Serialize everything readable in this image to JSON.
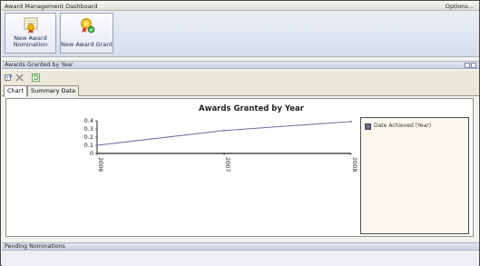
{
  "window": {
    "title": "Award Management Dashboard",
    "options_label": "Options..."
  },
  "ribbon": {
    "buttons": [
      {
        "label": "New Award Nomination",
        "icon": "award-nomination-icon"
      },
      {
        "label": "New Award Grant",
        "icon": "award-grant-icon"
      }
    ]
  },
  "awards_panel": {
    "title": "Awards Granted by Year",
    "toolbar_icons": [
      "grid-settings-icon",
      "delete-icon",
      "refresh-icon"
    ],
    "tabs": [
      {
        "label": "Chart",
        "active": true
      },
      {
        "label": "Summary Data",
        "active": false
      }
    ]
  },
  "chart_data": {
    "type": "line",
    "title": "Awards Granted by Year",
    "x": [
      "2006",
      "2007",
      "2008"
    ],
    "series": [
      {
        "name": "Date Achieved (Year)",
        "values": [
          0.1,
          0.28,
          0.39
        ],
        "color": "#6f6aa0"
      }
    ],
    "y_ticks": [
      "0.4",
      "0.3",
      "0.2",
      "0.1",
      "0"
    ],
    "ylim": [
      0,
      0.4
    ],
    "grid": false,
    "legend_position": "right"
  },
  "pending_panel": {
    "title": "Pending Nominations"
  }
}
